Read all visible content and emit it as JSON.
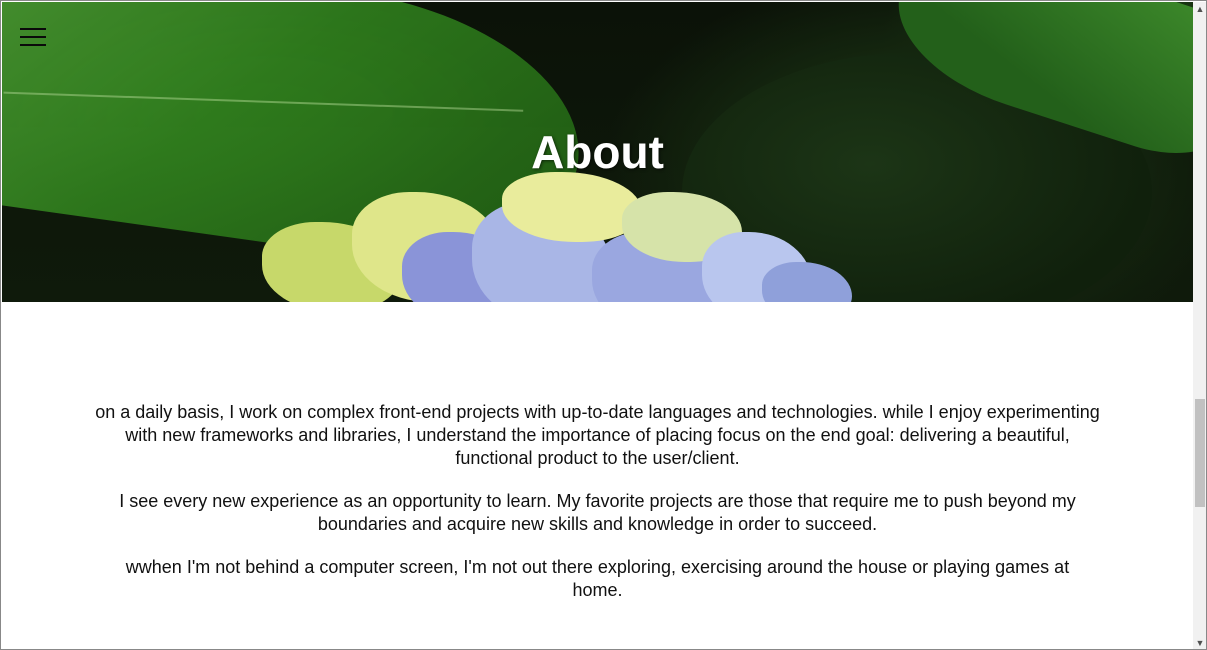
{
  "header": {
    "title": "About",
    "menu_icon": "hamburger-menu-icon"
  },
  "about": {
    "paragraphs": [
      "on a daily basis, I work on complex front-end projects with up-to-date languages and technologies. while I enjoy experimenting with new frameworks and libraries, I understand the importance of placing focus on the end goal: delivering a beautiful, functional product to the user/client.",
      "I see every new experience as an opportunity to learn. My favorite projects are those that require me to push beyond my boundaries and acquire new skills and knowledge in order to succeed.",
      "wwhen I'm not behind a computer screen, I'm not out there exploring, exercising around the house or playing games at home."
    ]
  },
  "scrollbar": {
    "up_arrow": "▲",
    "down_arrow": "▼",
    "position_fraction": 0.61
  },
  "colors": {
    "text": "#111111",
    "title": "#ffffff",
    "background": "#ffffff"
  }
}
